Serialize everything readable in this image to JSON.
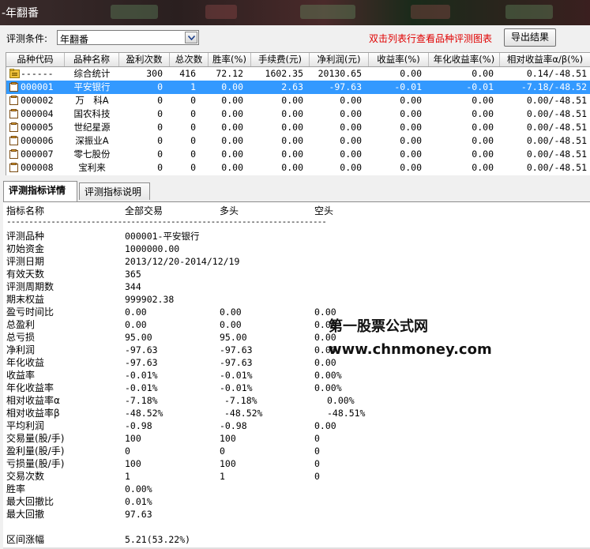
{
  "window": {
    "title": "-年翻番"
  },
  "toolbar": {
    "condition_label": "评测条件:",
    "condition_value": "年翻番",
    "hint": "双击列表行查看品种评测图表",
    "export_label": "导出结果"
  },
  "grid": {
    "columns": [
      "品种代码",
      "品种名称",
      "盈利次数",
      "总次数",
      "胜率(%)",
      "手续费(元)",
      "净利润(元)",
      "收益率(%)",
      "年化收益率(%)",
      "相对收益率α/β(%)"
    ],
    "rows": [
      {
        "code": "------",
        "name": "综合统计",
        "win": "300",
        "total": "416",
        "rate": "72.12",
        "fee": "1602.35",
        "profit": "20130.65",
        "ret": "0.00",
        "ann": "0.00",
        "rel": "0.14/-48.51",
        "icon": "summary"
      },
      {
        "code": "000001",
        "name": "平安银行",
        "win": "0",
        "total": "1",
        "rate": "0.00",
        "fee": "2.63",
        "profit": "-97.63",
        "ret": "-0.01",
        "ann": "-0.01",
        "rel": "-7.18/-48.52",
        "icon": "doc",
        "selected": true
      },
      {
        "code": "000002",
        "name": "万　科A",
        "win": "0",
        "total": "0",
        "rate": "0.00",
        "fee": "0.00",
        "profit": "0.00",
        "ret": "0.00",
        "ann": "0.00",
        "rel": "0.00/-48.51",
        "icon": "doc"
      },
      {
        "code": "000004",
        "name": "国农科技",
        "win": "0",
        "total": "0",
        "rate": "0.00",
        "fee": "0.00",
        "profit": "0.00",
        "ret": "0.00",
        "ann": "0.00",
        "rel": "0.00/-48.51",
        "icon": "doc"
      },
      {
        "code": "000005",
        "name": "世纪星源",
        "win": "0",
        "total": "0",
        "rate": "0.00",
        "fee": "0.00",
        "profit": "0.00",
        "ret": "0.00",
        "ann": "0.00",
        "rel": "0.00/-48.51",
        "icon": "doc"
      },
      {
        "code": "000006",
        "name": "深振业A",
        "win": "0",
        "total": "0",
        "rate": "0.00",
        "fee": "0.00",
        "profit": "0.00",
        "ret": "0.00",
        "ann": "0.00",
        "rel": "0.00/-48.51",
        "icon": "doc"
      },
      {
        "code": "000007",
        "name": "零七股份",
        "win": "0",
        "total": "0",
        "rate": "0.00",
        "fee": "0.00",
        "profit": "0.00",
        "ret": "0.00",
        "ann": "0.00",
        "rel": "0.00/-48.51",
        "icon": "doc"
      },
      {
        "code": "000008",
        "name": "宝利来",
        "win": "0",
        "total": "0",
        "rate": "0.00",
        "fee": "0.00",
        "profit": "0.00",
        "ret": "0.00",
        "ann": "0.00",
        "rel": "0.00/-48.51",
        "icon": "doc"
      }
    ]
  },
  "tabs": [
    {
      "label": "评测指标详情",
      "active": true
    },
    {
      "label": "评测指标说明",
      "active": false
    }
  ],
  "detail": {
    "header": {
      "k": "指标名称",
      "v1": "全部交易",
      "v2": "多头",
      "v3": "空头"
    },
    "separator": "------------------------------------------------------------------------",
    "lines": [
      {
        "k": "评测品种",
        "v1": "000001-平安银行"
      },
      {
        "k": "初始资金",
        "v1": "1000000.00"
      },
      {
        "k": "评测日期",
        "v1": "2013/12/20-2014/12/19"
      },
      {
        "k": "有效天数",
        "v1": "365"
      },
      {
        "k": "评测周期数",
        "v1": "344"
      },
      {
        "k": "期末权益",
        "v1": "999902.38"
      },
      {
        "k": "盈亏时间比",
        "v1": "0.00",
        "v2": "0.00",
        "v3": "0.00"
      },
      {
        "k": "总盈利",
        "v1": "0.00",
        "v2": "0.00",
        "v3": "0.00"
      },
      {
        "k": "总亏损",
        "v1": "95.00",
        "v2": "95.00",
        "v3": "0.00"
      },
      {
        "k": "净利润",
        "v1": "-97.63",
        "v2": "-97.63",
        "v3": "0.00"
      },
      {
        "k": "年化收益",
        "v1": "-97.63",
        "v2": "-97.63",
        "v3": "0.00"
      },
      {
        "k": "收益率",
        "v1": "-0.01%",
        "v2": "-0.01%",
        "v3": "0.00%"
      },
      {
        "k": "年化收益率",
        "v1": "-0.01%",
        "v2": "-0.01%",
        "v3": "0.00%"
      },
      {
        "k": "相对收益率α",
        "v1": "-7.18%",
        "v2": "-7.18%",
        "v3": "0.00%",
        "shift": true
      },
      {
        "k": "相对收益率β",
        "v1": "-48.52%",
        "v2": "-48.52%",
        "v3": "-48.51%",
        "shift": true
      },
      {
        "k": "平均利润",
        "v1": "-0.98",
        "v2": "-0.98",
        "v3": "0.00"
      },
      {
        "k": "交易量(股/手)",
        "v1": "100",
        "v2": "100",
        "v3": "0"
      },
      {
        "k": "盈利量(股/手)",
        "v1": "0",
        "v2": "0",
        "v3": "0"
      },
      {
        "k": "亏损量(股/手)",
        "v1": "100",
        "v2": "100",
        "v3": "0"
      },
      {
        "k": "交易次数",
        "v1": "1",
        "v2": "1",
        "v3": "0"
      },
      {
        "k": "胜率",
        "v1": "0.00%"
      },
      {
        "k": "最大回撤比",
        "v1": "0.01%"
      },
      {
        "k": "最大回撤",
        "v1": "97.63"
      }
    ],
    "last_line": {
      "k": "区间涨幅",
      "v1": "5.21(53.22%)"
    }
  },
  "watermark": {
    "line1": "第一股票公式网",
    "line2": "www.chnmoney.com"
  },
  "colors": {
    "selection": "#3399ff",
    "hint": "#e00000"
  }
}
